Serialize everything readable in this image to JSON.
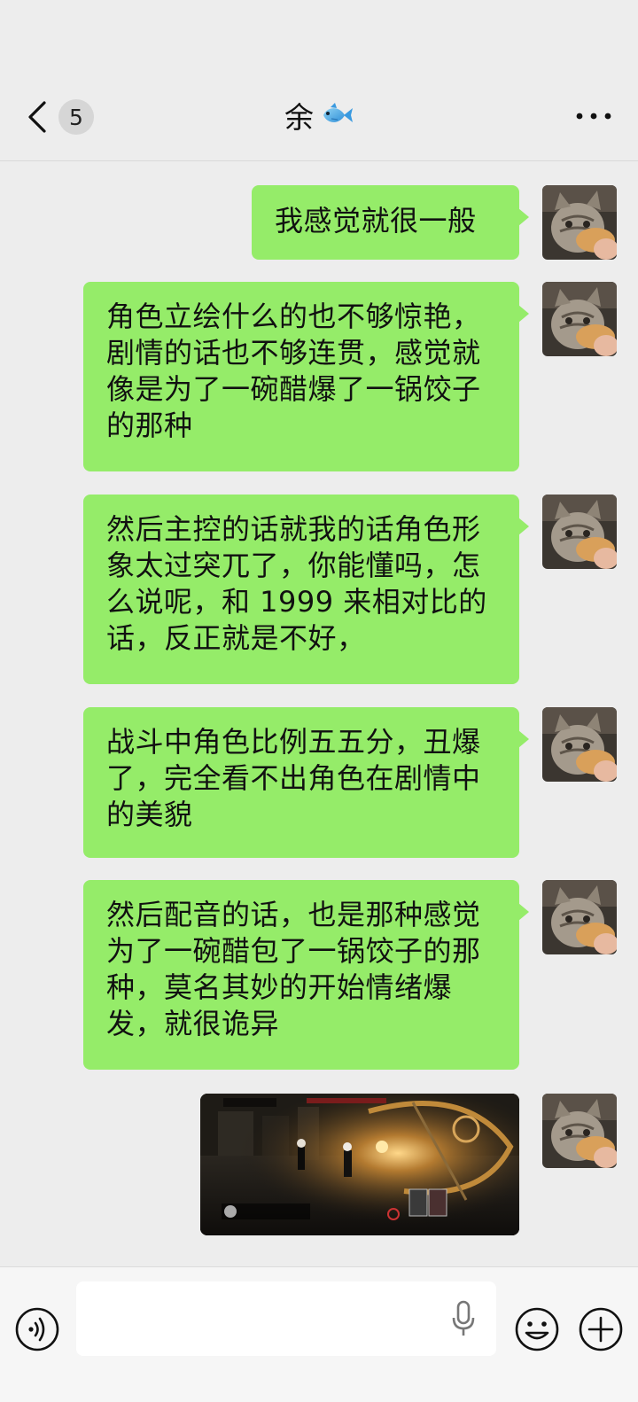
{
  "header": {
    "back_count": "5",
    "title": "余",
    "title_emoji_icon": "fish-icon",
    "more_icon": "more-horizontal-icon"
  },
  "messages": [
    {
      "type": "text",
      "text": "我感觉就很一般"
    },
    {
      "type": "text",
      "text": "角色立绘什么的也不够惊艳，剧情的话也不够连贯，感觉就像是为了一碗醋爆了一锅饺子的那种"
    },
    {
      "type": "text",
      "text": "然后主控的话就我的话角色形象太过突兀了，你能懂吗，怎么说呢，和 1999 来相对比的话，反正就是不好，"
    },
    {
      "type": "text",
      "text": "战斗中角色比例五五分，丑爆了，完全看不出角色在剧情中的美貌"
    },
    {
      "type": "text",
      "text": "然后配音的话，也是那种感觉为了一碗醋包了一锅饺子的那种，莫名其妙的开始情绪爆发，就很诡异"
    },
    {
      "type": "image",
      "description_icon": "game-screenshot-image"
    }
  ],
  "input": {
    "placeholder": "",
    "value": ""
  },
  "colors": {
    "background": "#ededed",
    "bubble_self": "#95ec69",
    "input_bar": "#f6f6f6"
  }
}
